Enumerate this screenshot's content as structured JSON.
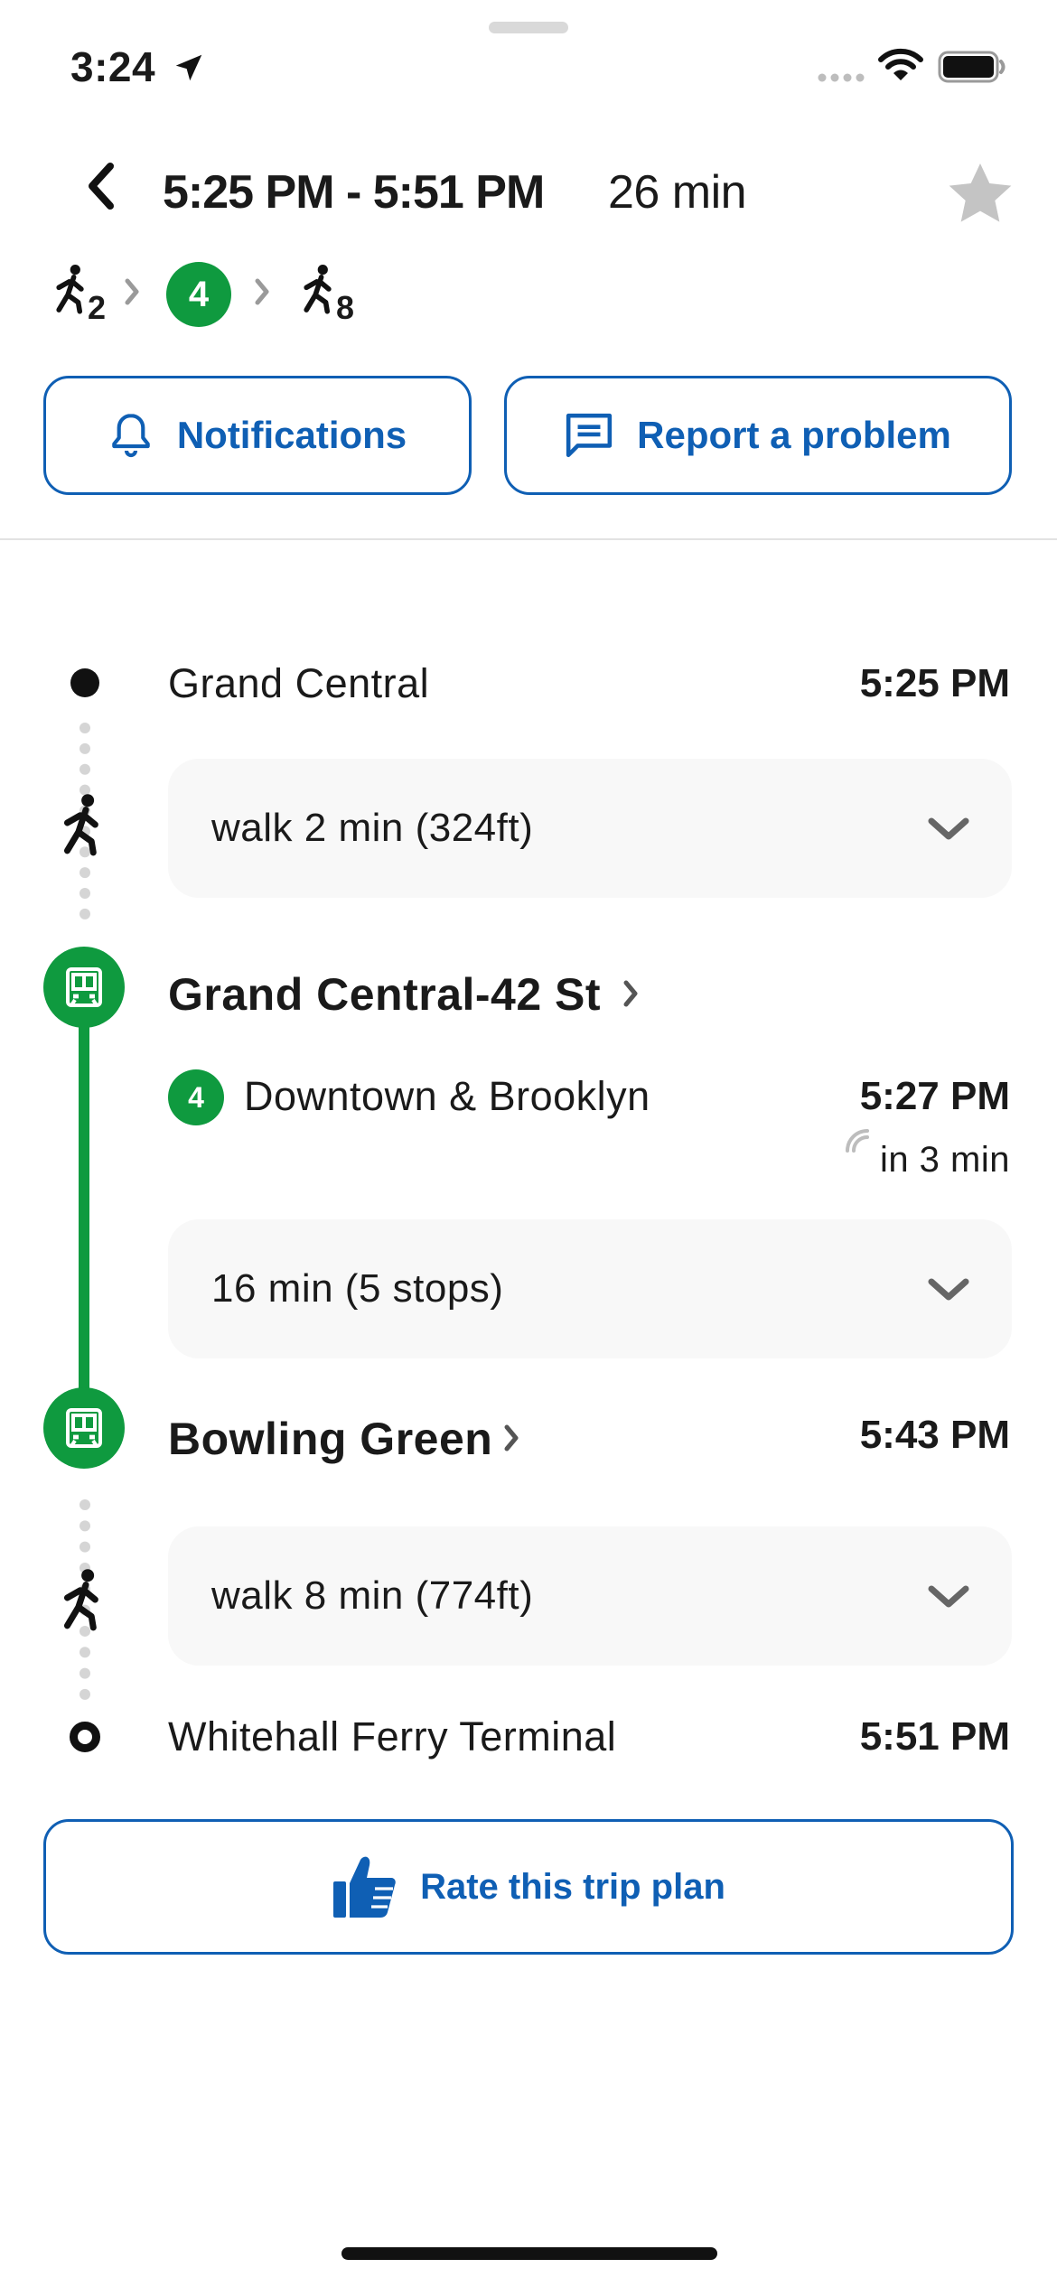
{
  "status_bar": {
    "time": "3:24"
  },
  "header": {
    "time_range": "5:25 PM - 5:51 PM",
    "duration": "26 min"
  },
  "summary": {
    "walk_before_minutes": "2",
    "route": "4",
    "walk_after_minutes": "8"
  },
  "actions": {
    "notifications_label": "Notifications",
    "report_label": "Report a problem"
  },
  "itinerary": {
    "origin": {
      "name": "Grand Central",
      "time": "5:25 PM"
    },
    "walk1": {
      "label": "walk 2 min (324ft)"
    },
    "board": {
      "station": "Grand Central-42 St",
      "route": "4",
      "direction": "Downtown & Brooklyn",
      "time": "5:27 PM",
      "realtime": "in 3 min"
    },
    "ride": {
      "label": "16 min (5 stops)"
    },
    "alight": {
      "station": "Bowling Green",
      "time": "5:43 PM"
    },
    "walk2": {
      "label": "walk 8 min (774ft)"
    },
    "destination": {
      "name": "Whitehall Ferry Terminal",
      "time": "5:51 PM"
    }
  },
  "rate_label": "Rate this trip plan",
  "colors": {
    "accent_blue": "#0f5fb4",
    "route_green": "#0f9a3f"
  }
}
